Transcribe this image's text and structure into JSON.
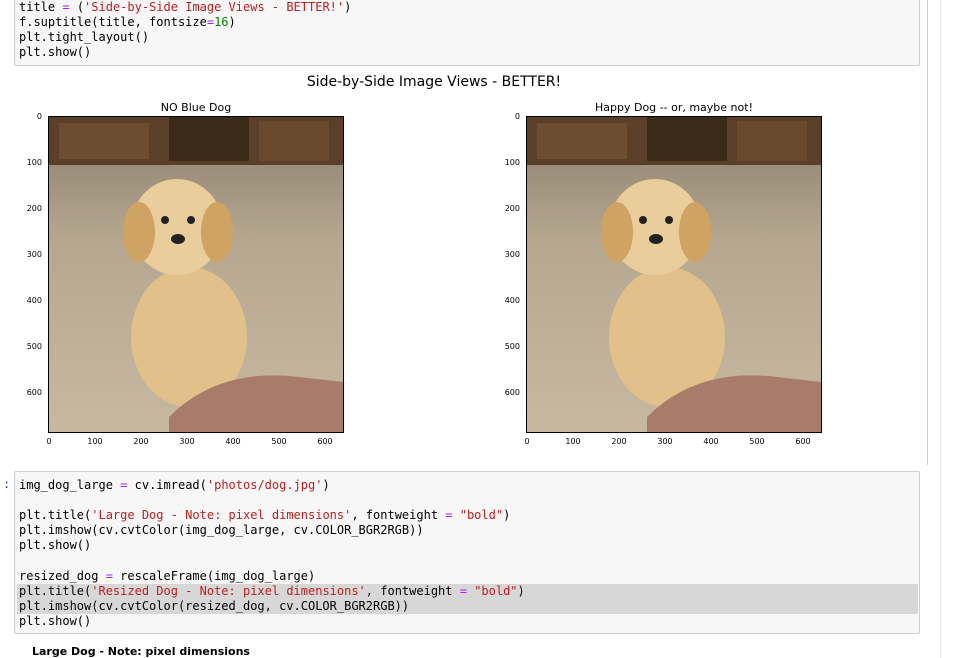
{
  "cell1": {
    "code": [
      [
        "title = ('Side-by-Side Image Views - BETTER!')"
      ],
      [
        "f.suptitle(title, fontsize=16)"
      ],
      [
        "plt.tight_layout()"
      ],
      [
        "plt.show()"
      ]
    ]
  },
  "figure": {
    "suptitle": "Side-by-Side Image Views - BETTER!",
    "left_title": "NO Blue Dog",
    "right_title": "Happy Dog -- or, maybe not!",
    "y_ticks": [
      "0",
      "100",
      "200",
      "300",
      "400",
      "500",
      "600"
    ],
    "x_ticks": [
      "0",
      "100",
      "200",
      "300",
      "400",
      "500",
      "600"
    ]
  },
  "cell2": {
    "prompt": ":",
    "lines": [
      "img_dog_large = cv.imread('photos/dog.jpg')",
      "",
      "plt.title('Large Dog - Note: pixel dimensions', fontweight = \"bold\")",
      "plt.imshow(cv.cvtColor(img_dog_large, cv.COLOR_BGR2RGB))",
      "plt.show()",
      "",
      "resized_dog = rescaleFrame(img_dog_large)",
      "plt.title('Resized Dog - Note: pixel dimensions', fontweight = \"bold\")",
      "plt.imshow(cv.cvtColor(resized_dog, cv.COLOR_BGR2RGB))",
      "plt.show()"
    ]
  },
  "bottom_title": "Large Dog - Note: pixel dimensions",
  "colors": {
    "string": "#ba2121",
    "number": "#008000",
    "operator": "#aa22ff",
    "cell_bg": "#f7f7f7",
    "highlight": "#d7d7d7"
  }
}
